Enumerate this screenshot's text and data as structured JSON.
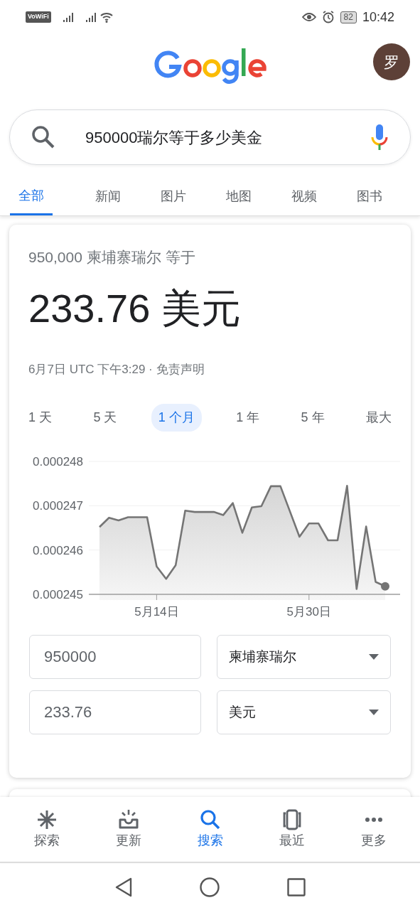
{
  "status_bar": {
    "wifi_calling": "VoWiFi",
    "battery": "82",
    "time": "10:42"
  },
  "header": {
    "avatar": "罗"
  },
  "search": {
    "value": "950000瑞尔等于多少美金"
  },
  "tabs": [
    {
      "label": "全部",
      "selected": true
    },
    {
      "label": "新闻",
      "selected": false
    },
    {
      "label": "图片",
      "selected": false
    },
    {
      "label": "地图",
      "selected": false
    },
    {
      "label": "视频",
      "selected": false
    },
    {
      "label": "图书",
      "selected": false
    }
  ],
  "converter": {
    "heading": "950,000 柬埔寨瑞尔 等于",
    "result": "233.76 美元",
    "timestamp": "6月7日 UTC 下午3:29 · ",
    "disclaimer": "免责声明",
    "ranges": [
      {
        "label": "1 天",
        "selected": false
      },
      {
        "label": "5 天",
        "selected": false
      },
      {
        "label": "1 个月",
        "selected": true
      },
      {
        "label": "1 年",
        "selected": false
      },
      {
        "label": "5 年",
        "selected": false
      },
      {
        "label": "最大",
        "selected": false
      }
    ],
    "chart_data": {
      "type": "area",
      "categories": [
        null,
        null,
        null,
        null,
        null,
        null,
        "5月14日",
        null,
        null,
        null,
        null,
        null,
        null,
        null,
        null,
        null,
        null,
        null,
        null,
        null,
        null,
        null,
        "5月30日",
        null,
        null,
        null,
        null,
        null,
        null,
        null,
        null
      ],
      "series": [
        {
          "color": "#757575",
          "values": [
            0.00024652,
            0.00024673,
            0.00024667,
            0.00024674,
            0.00024674,
            0.00024674,
            0.00024563,
            0.00024535,
            0.00024566,
            0.00024689,
            0.00024686,
            0.00024686,
            0.00024686,
            0.00024679,
            0.00024706,
            0.00024639,
            0.00024696,
            0.00024699,
            0.00024744,
            0.00024744,
            0.00024687,
            0.0002463,
            0.0002466,
            0.0002466,
            0.00024622,
            0.00024622,
            0.00024745,
            0.00024512,
            0.00024653,
            0.00024528,
            0.00024518
          ]
        }
      ],
      "ylim": [
        0.000245,
        0.000248
      ],
      "yticks": [
        {
          "value": 0.000245,
          "label": "0.000245"
        },
        {
          "value": 0.000246,
          "label": "0.000246"
        },
        {
          "value": 0.000247,
          "label": "0.000247"
        },
        {
          "value": 0.000248,
          "label": "0.000248"
        }
      ]
    },
    "from": {
      "amount": "950000",
      "currency": "柬埔寨瑞尔"
    },
    "to": {
      "amount": "233.76",
      "currency": "美元"
    }
  },
  "bottom_nav": [
    {
      "label": "探索",
      "kind": "explore",
      "selected": false
    },
    {
      "label": "更新",
      "kind": "updates",
      "selected": false
    },
    {
      "label": "搜索",
      "kind": "search",
      "selected": true
    },
    {
      "label": "最近",
      "kind": "recent",
      "selected": false
    },
    {
      "label": "更多",
      "kind": "more",
      "selected": false
    }
  ]
}
